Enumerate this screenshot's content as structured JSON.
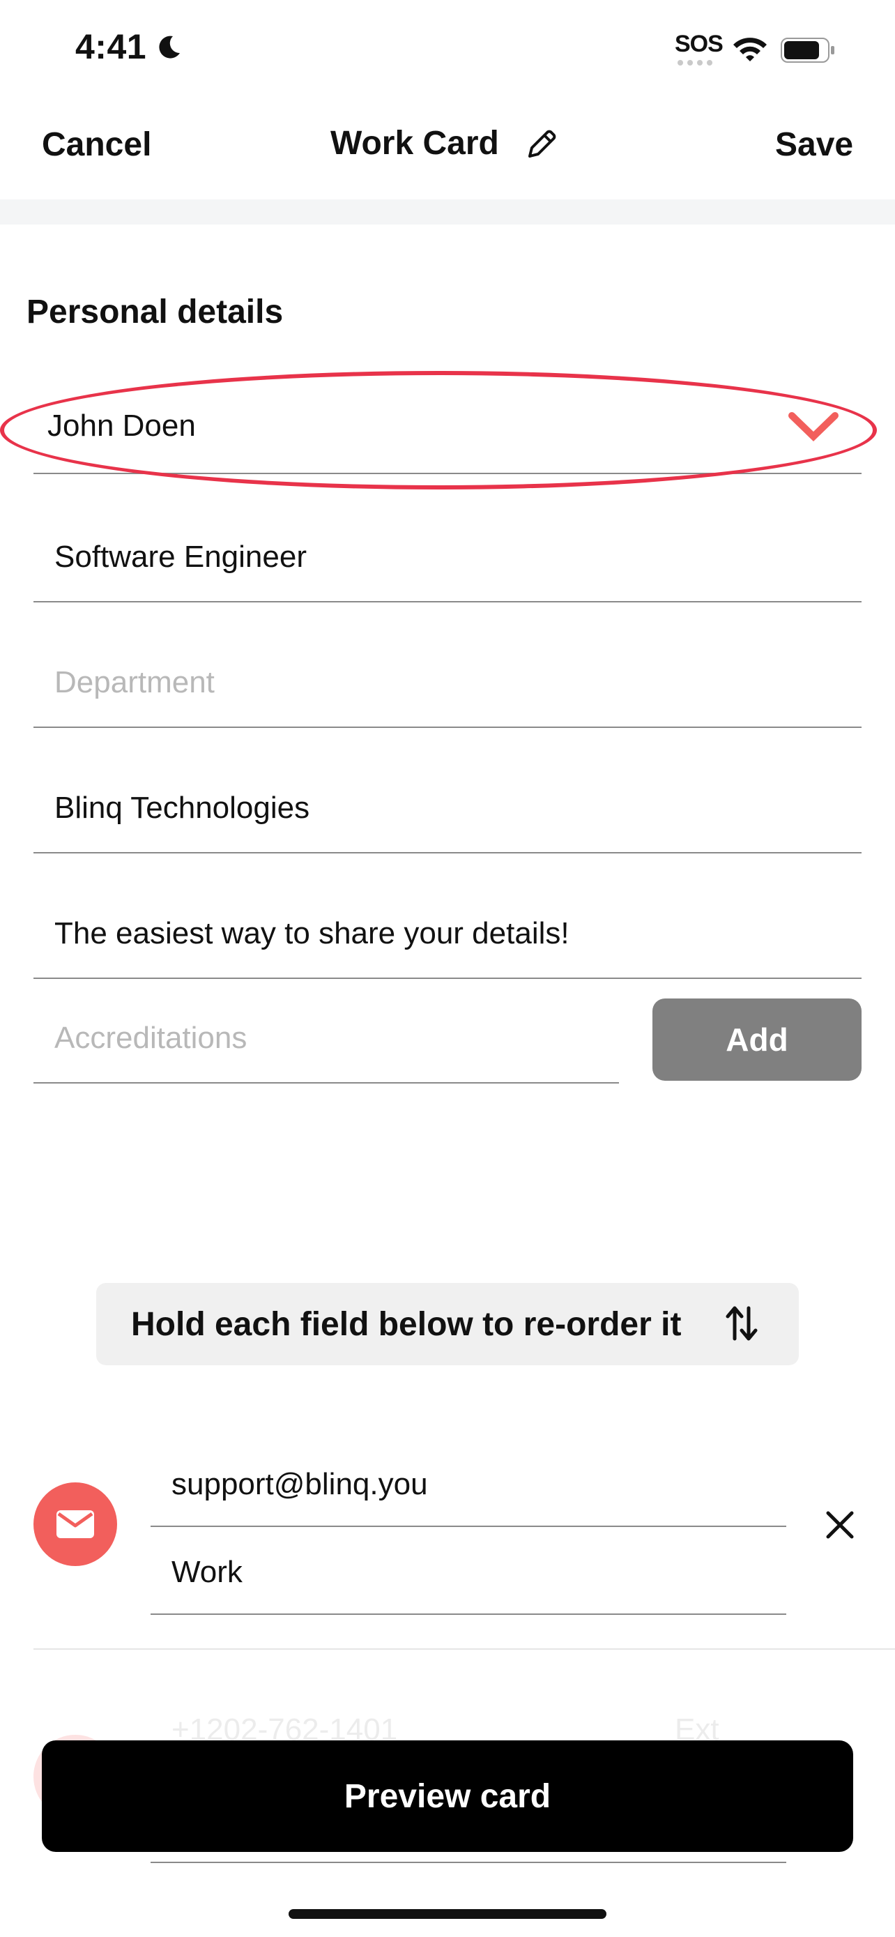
{
  "status": {
    "time": "4:41",
    "sos": "SOS"
  },
  "nav": {
    "cancel": "Cancel",
    "title": "Work Card",
    "save": "Save"
  },
  "personal": {
    "title": "Personal details",
    "name": "John Doen",
    "job_title": "Software Engineer",
    "department_placeholder": "Department",
    "company": "Blinq Technologies",
    "headline": "The easiest way to share your details!",
    "accreditations_placeholder": "Accreditations",
    "add_label": "Add"
  },
  "hint": {
    "text": "Hold each field below to re-order it"
  },
  "email_entry": {
    "value": "support@blinq.you",
    "label": "Work"
  },
  "phone_entry": {
    "placeholder": "+1202-762-1401",
    "ext_placeholder": "Ext"
  },
  "preview": {
    "label": "Preview card"
  },
  "colors": {
    "accent": "#f25f5c",
    "highlight": "#e8334a",
    "add_button": "#808080"
  }
}
